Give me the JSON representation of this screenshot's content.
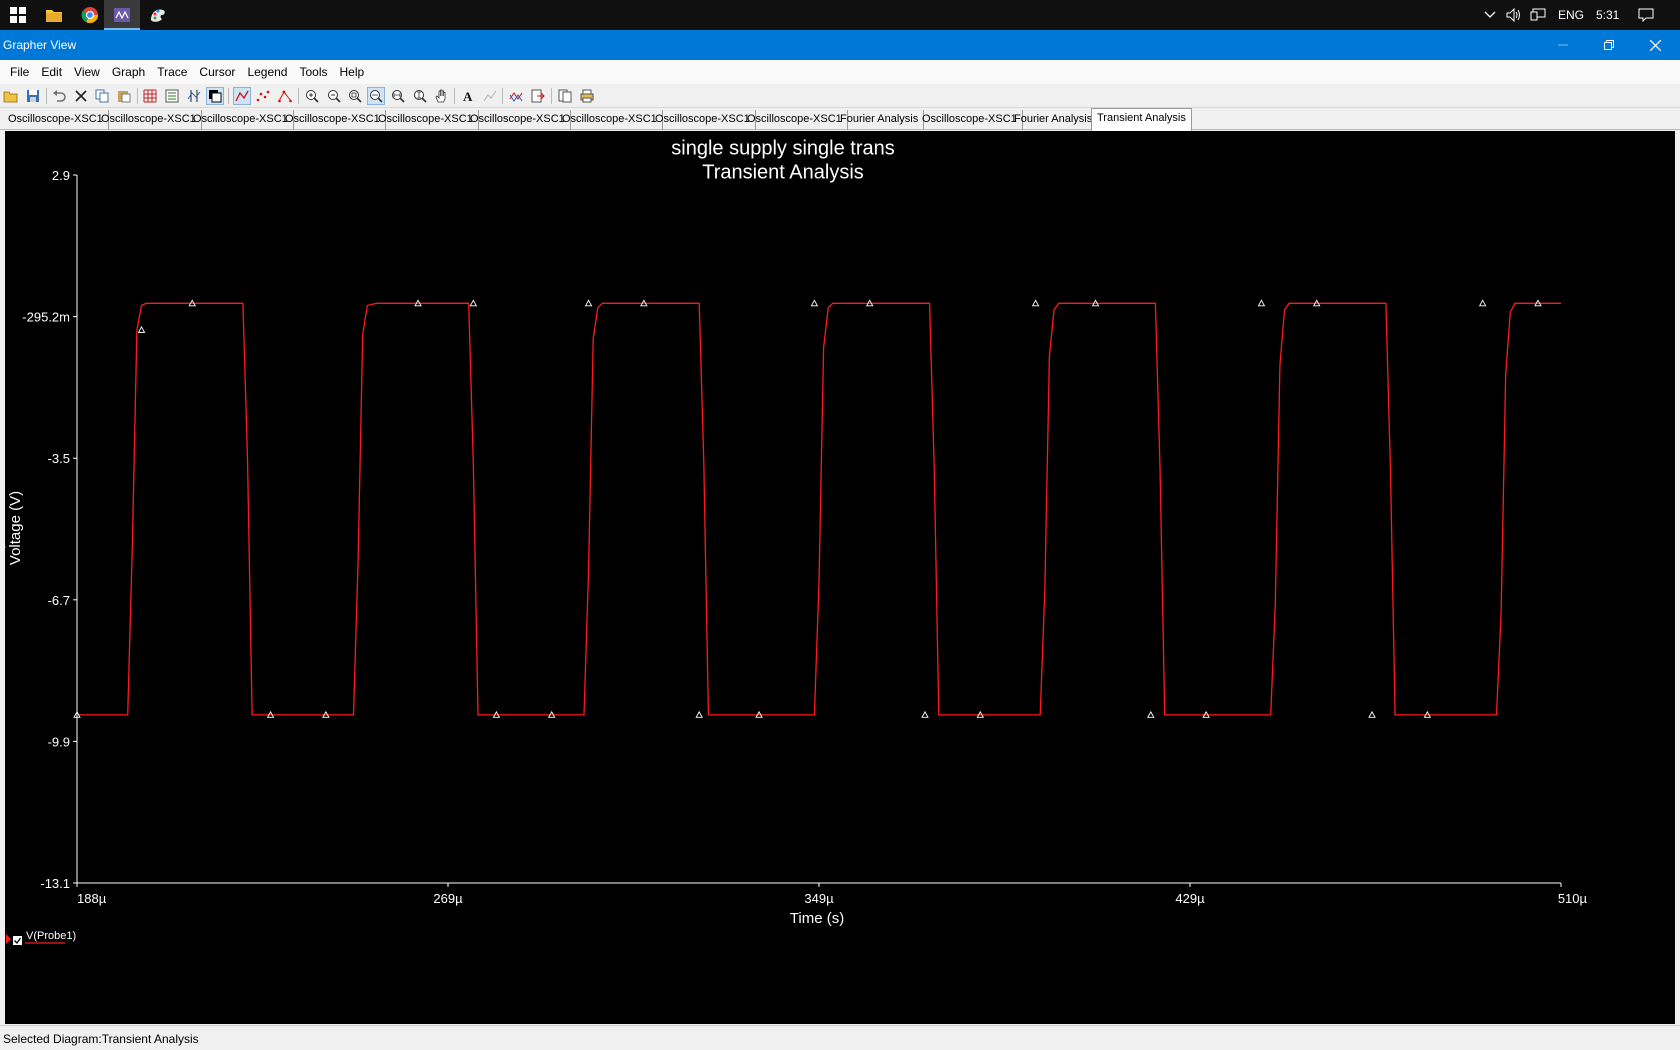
{
  "taskbar": {
    "items": [
      "start-icon",
      "file-explorer-icon",
      "chrome-icon",
      "multisim-icon",
      "paint-icon"
    ],
    "language": "ENG",
    "clock": "5:31"
  },
  "window": {
    "title": "Grapher View"
  },
  "menu": [
    "File",
    "Edit",
    "View",
    "Graph",
    "Trace",
    "Cursor",
    "Legend",
    "Tools",
    "Help"
  ],
  "tabs": [
    "Oscilloscope-XSC1",
    "Oscilloscope-XSC1",
    "Oscilloscope-XSC1",
    "Oscilloscope-XSC1",
    "Oscilloscope-XSC1",
    "Oscilloscope-XSC1",
    "Oscilloscope-XSC1",
    "Oscilloscope-XSC1",
    "Oscilloscope-XSC1",
    "Fourier Analysis",
    "Oscilloscope-XSC1",
    "Fourier Analysis",
    "Transient Analysis"
  ],
  "active_tab_index": 12,
  "status": {
    "text": "Selected Diagram:Transient Analysis"
  },
  "colors": {
    "trace": "#ff1a1a",
    "plot_background": "#000000",
    "titlebar": "#0078d7"
  },
  "chart_data": {
    "type": "line",
    "title": "single supply single trans",
    "subtitle": "Transient Analysis",
    "xlabel": "Time (s)",
    "ylabel": "Voltage (V)",
    "x_ticks": [
      "188µ",
      "269µ",
      "349µ",
      "429µ",
      "510µ"
    ],
    "y_ticks": [
      "2.9",
      "-295.2m",
      "-3.5",
      "-6.7",
      "-9.9",
      "-13.1"
    ],
    "xlim": [
      0.000188,
      0.00051
    ],
    "ylim": [
      -13.1,
      2.9
    ],
    "grid": false,
    "legend": {
      "position": "bottom-left",
      "entries": [
        "V(Probe1)"
      ]
    },
    "series": [
      {
        "name": "V(Probe1)",
        "x": [
          0.000188,
          0.000199,
          0.0002,
          0.000201,
          0.000202,
          0.000203,
          0.0002115,
          0.000224,
          0.000225,
          0.000226,
          0.000236,
          0.000248,
          0.000249,
          0.00025,
          0.000251,
          0.000253,
          0.0002605,
          0.000273,
          0.000274,
          0.000275,
          0.000286,
          0.000298,
          0.000299,
          0.0003,
          0.000301,
          0.000302,
          0.000311,
          0.000323,
          0.000324,
          0.000325,
          0.000336,
          0.000348,
          0.000349,
          0.00035,
          0.000351,
          0.000352,
          0.0003605,
          0.000373,
          0.000374,
          0.000375,
          0.000386,
          0.000397,
          0.000398,
          0.000399,
          0.0004,
          0.000401,
          0.00041,
          0.000422,
          0.000423,
          0.000424,
          0.000435,
          0.000447,
          0.000448,
          0.000449,
          0.00045,
          0.000451,
          0.0004595,
          0.000472,
          0.000473,
          0.000474,
          0.000485,
          0.000496,
          0.000497,
          0.000498,
          0.000499,
          0.0005,
          0.00051
        ],
        "y": [
          -9.3,
          -9.3,
          -5.5,
          -0.6,
          -0.05,
          0.0,
          0.0,
          0.0,
          -3.5,
          -9.3,
          -9.3,
          -9.3,
          -5.8,
          -0.7,
          -0.05,
          0.0,
          0.0,
          0.0,
          -3.6,
          -9.3,
          -9.3,
          -9.3,
          -6.0,
          -0.8,
          -0.1,
          0.0,
          0.0,
          0.0,
          -3.6,
          -9.3,
          -9.3,
          -9.3,
          -6.3,
          -1.0,
          -0.1,
          0.0,
          0.0,
          0.0,
          -3.7,
          -9.3,
          -9.3,
          -9.3,
          -6.5,
          -1.2,
          -0.15,
          0.0,
          0.0,
          0.0,
          -3.7,
          -9.3,
          -9.3,
          -9.3,
          -6.8,
          -1.4,
          -0.15,
          0.0,
          0.0,
          0.0,
          -3.8,
          -9.3,
          -9.3,
          -9.3,
          -7.0,
          -1.6,
          -0.2,
          0.0,
          0.0
        ]
      }
    ],
    "markers": {
      "x": [
        0.000188,
        0.000202,
        0.000213,
        0.00023,
        0.000242,
        0.000262,
        0.000274,
        0.000279,
        0.000291,
        0.000299,
        0.000311,
        0.000323,
        0.000336,
        0.000348,
        0.00036,
        0.000372,
        0.000384,
        0.000396,
        0.000409,
        0.000421,
        0.000433,
        0.000445,
        0.000457,
        0.000469,
        0.000481,
        0.000493,
        0.000505
      ],
      "y": [
        -9.3,
        -0.6,
        0.0,
        -9.3,
        -9.3,
        0.0,
        0.0,
        -9.3,
        -9.3,
        0.0,
        0.0,
        -9.3,
        -9.3,
        0.0,
        0.0,
        -9.3,
        -9.3,
        0.0,
        0.0,
        -9.3,
        -9.3,
        0.0,
        0.0,
        -9.3,
        -9.3,
        0.0,
        0.0
      ]
    }
  }
}
